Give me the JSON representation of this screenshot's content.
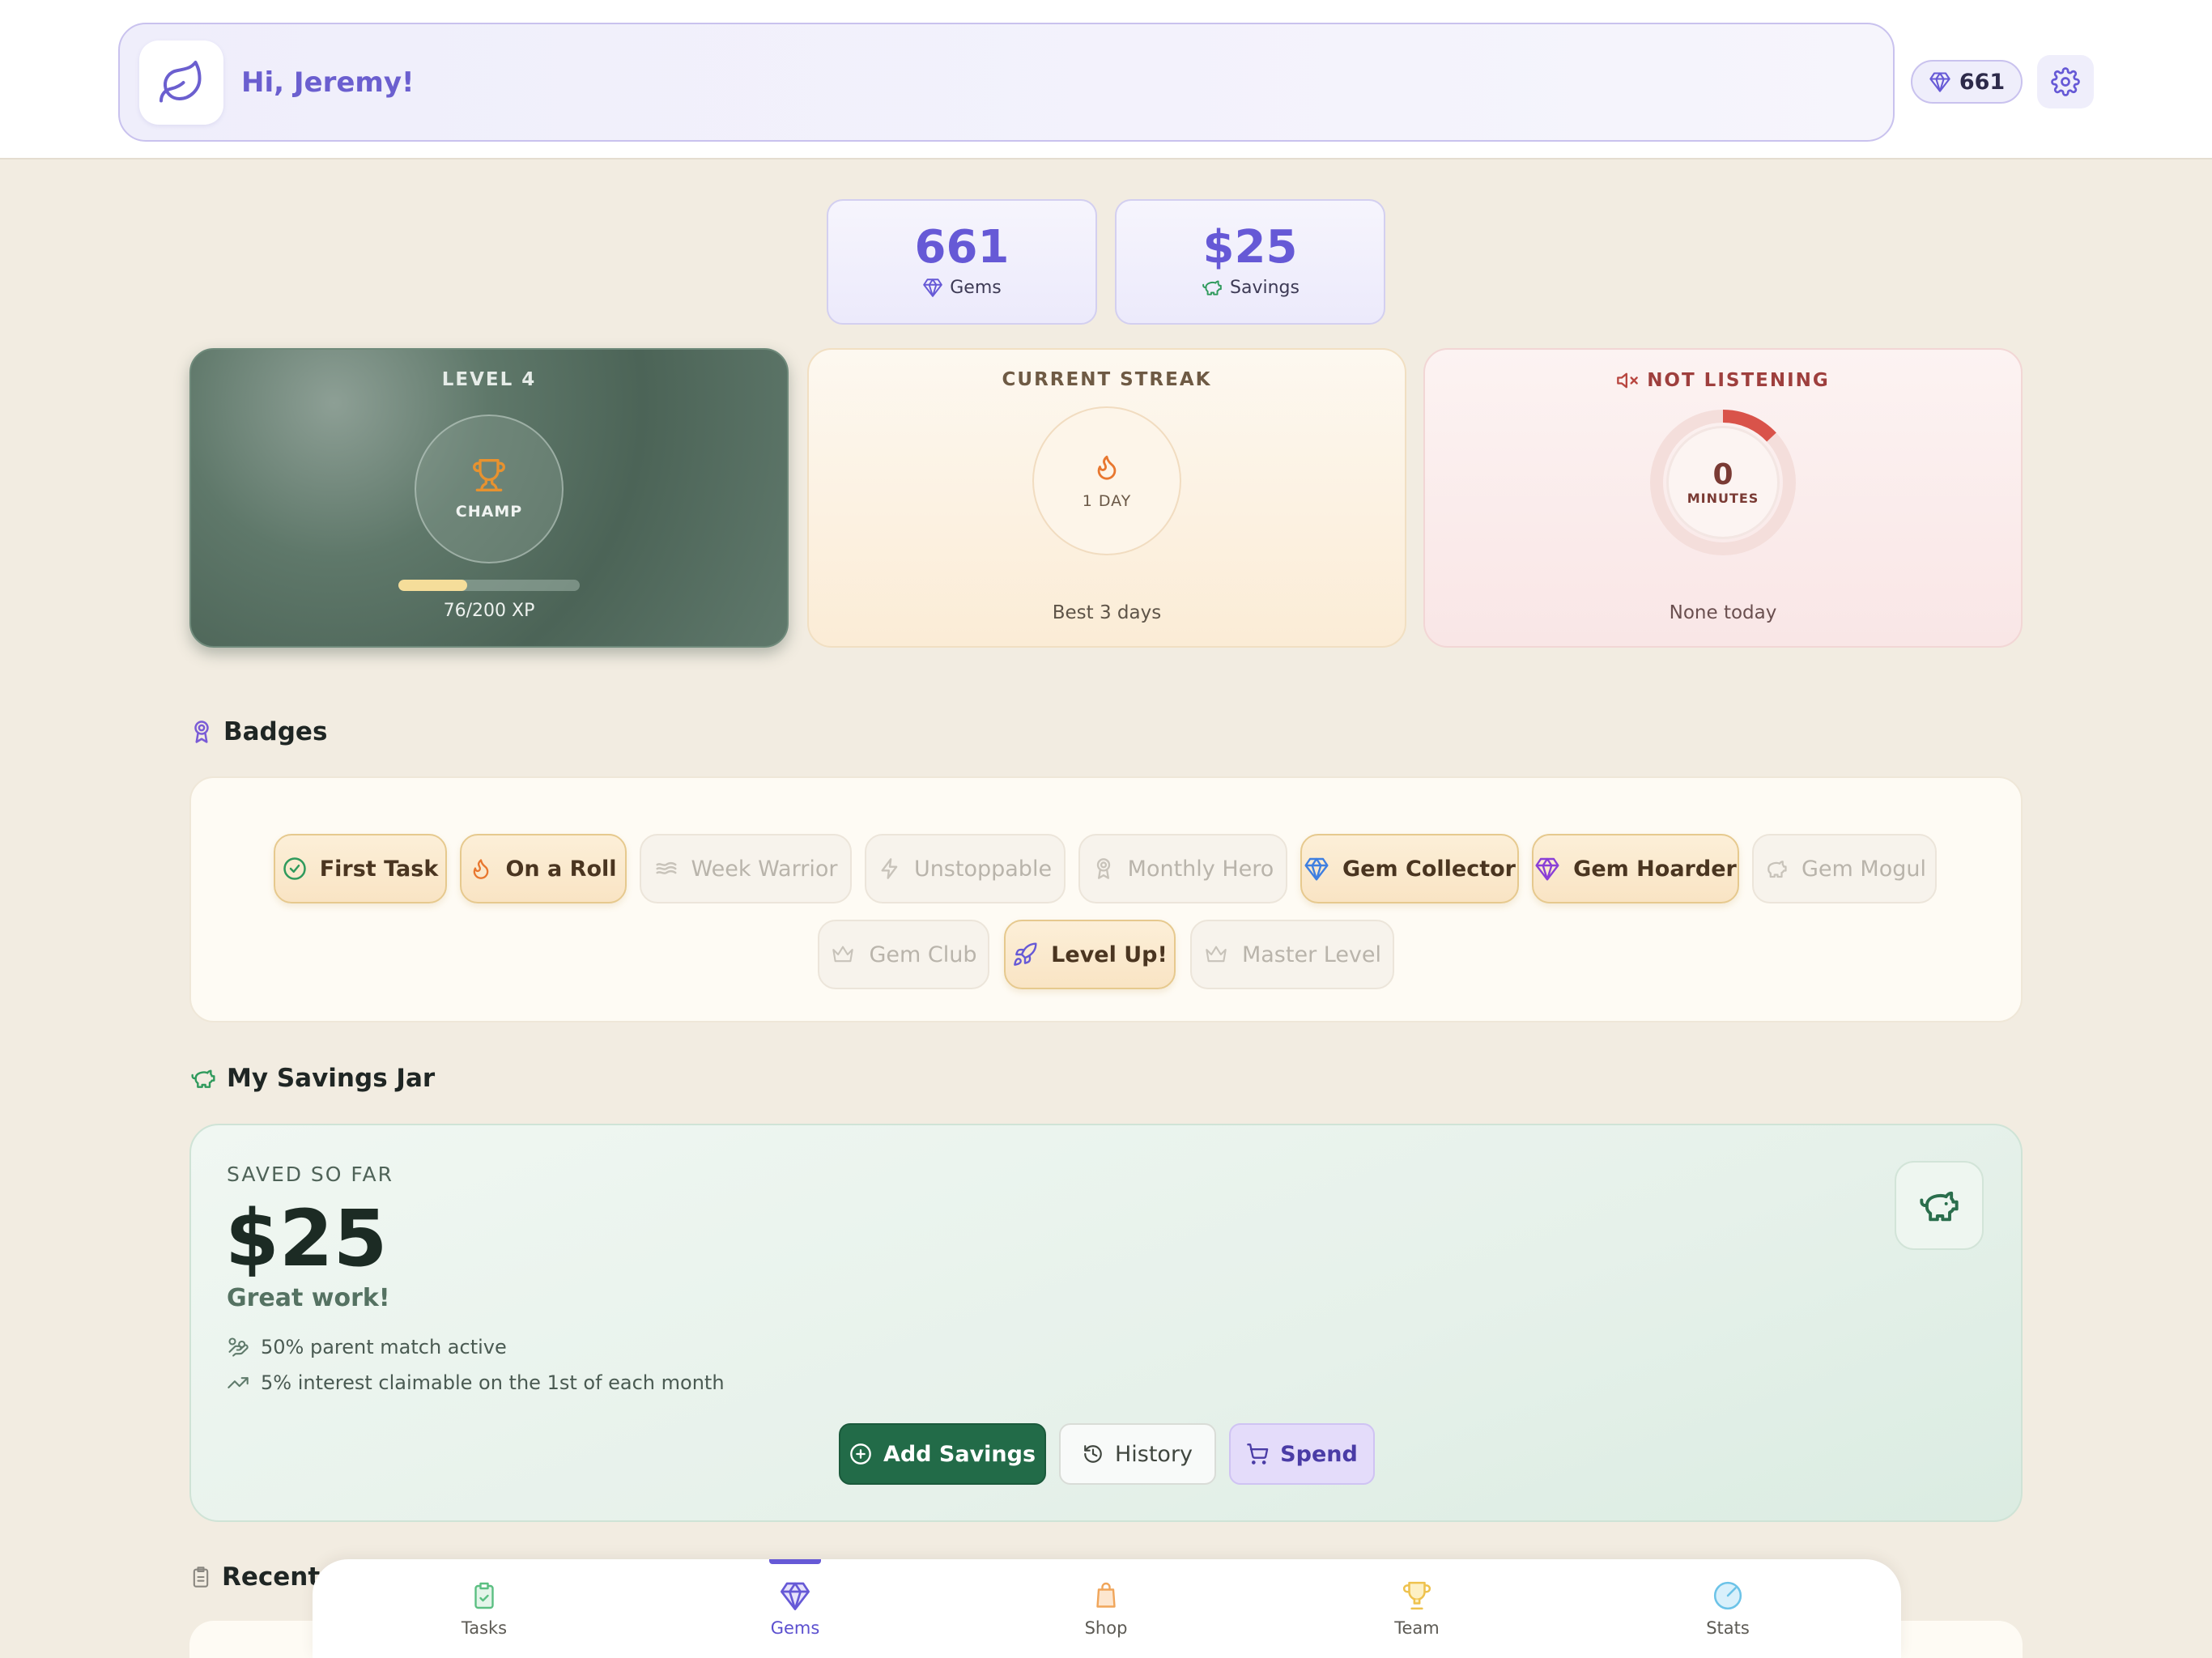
{
  "header": {
    "greeting": "Hi, Jeremy!",
    "gem_count": "661",
    "logo_icon": "leaf-icon",
    "settings_icon": "gear-icon"
  },
  "stats": {
    "gems_value": "661",
    "gems_label": "Gems",
    "savings_value": "$25",
    "savings_label": "Savings"
  },
  "level_card": {
    "title": "LEVEL 4",
    "rank": "CHAMP",
    "xp_text": "76/200 XP",
    "xp_progress": 0.38
  },
  "streak_card": {
    "title": "CURRENT STREAK",
    "days": "1 DAY",
    "best": "Best 3 days"
  },
  "listen_card": {
    "title": "NOT LISTENING",
    "minutes": "0",
    "unit": "MINUTES",
    "footer": "None today"
  },
  "badges": {
    "title": "Badges",
    "items": [
      {
        "label": "First Task",
        "icon": "check-circle-icon",
        "earned": true
      },
      {
        "label": "On a Roll",
        "icon": "flame-icon",
        "earned": true
      },
      {
        "label": "Week Warrior",
        "icon": "wind-icon",
        "earned": false
      },
      {
        "label": "Unstoppable",
        "icon": "lightning-icon",
        "earned": false
      },
      {
        "label": "Monthly Hero",
        "icon": "medal-icon",
        "earned": false
      },
      {
        "label": "Gem Collector",
        "icon": "gem-icon",
        "earned": true
      },
      {
        "label": "Gem Hoarder",
        "icon": "gem-icon",
        "earned": true
      },
      {
        "label": "Gem Mogul",
        "icon": "piggy-bank-icon",
        "earned": false
      },
      {
        "label": "Gem Club",
        "icon": "crown-icon",
        "earned": false
      },
      {
        "label": "Level Up!",
        "icon": "rocket-icon",
        "earned": true
      },
      {
        "label": "Master Level",
        "icon": "crown-icon",
        "earned": false
      }
    ]
  },
  "savings": {
    "title": "My Savings Jar",
    "saved_label": "SAVED SO FAR",
    "amount": "$25",
    "message": "Great work!",
    "perk_match": "50% parent match active",
    "perk_interest": "5% interest claimable on the 1st of each month",
    "add_label": "Add Savings",
    "history_label": "History",
    "spend_label": "Spend"
  },
  "recent": {
    "title": "Recent"
  },
  "nav": {
    "tasks": "Tasks",
    "gems": "Gems",
    "shop": "Shop",
    "team": "Team",
    "stats": "Stats",
    "active": "Gems"
  },
  "colors": {
    "accent": "#6659d6",
    "savings_green": "#226b48",
    "background": "#f2ece1"
  }
}
